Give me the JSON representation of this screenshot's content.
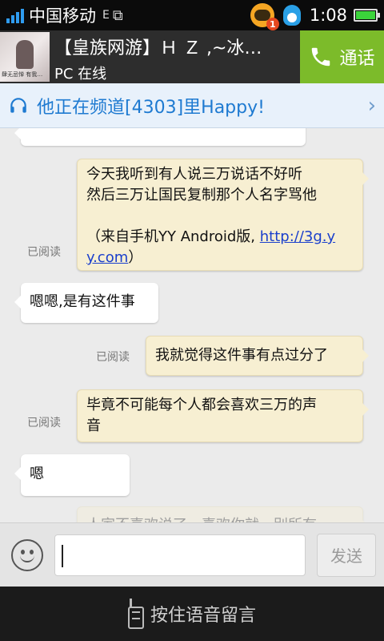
{
  "status_bar": {
    "carrier": "中国移动",
    "network_small": "E",
    "time": "1:08",
    "notification_badge": "1",
    "icons": [
      "signal-icon",
      "vibrate-icon",
      "yy-icon",
      "qq-icon",
      "battery-icon"
    ]
  },
  "header": {
    "title": "【皇族网游】Ｈ Ｚ ,~冰…",
    "status": "PC 在线",
    "avatar_caption": "肆无忌惮 有我…",
    "call_label": "通话",
    "colors": {
      "call_bg": "#7cbb2a",
      "header_bg": "#2d2d2d"
    }
  },
  "channel": {
    "text": "他正在频道[4303]里Happy!",
    "color": "#1e7ad1"
  },
  "messages": [
    {
      "side": "right",
      "read": "已阅读",
      "line1": "今天我听到有人说三万说话不好听",
      "line2": "然后三万让国民复制那个人名字骂他",
      "line3_prefix": "（来自手机YY Android版, ",
      "link_part1": "http://3g.y",
      "link_part2": "y.com",
      "line4_suffix": "）"
    },
    {
      "side": "left",
      "text": "嗯嗯,是有这件事"
    },
    {
      "side": "right",
      "read": "已阅读",
      "text": "我就觉得这件事有点过分了"
    },
    {
      "side": "right",
      "read": "已阅读",
      "line1": "毕竟不可能每个人都会喜欢三万的声",
      "line2": "音"
    },
    {
      "side": "left",
      "text": "嗯"
    },
    {
      "side": "right",
      "text": "人家不喜欢说了，喜欢你就…别所有"
    }
  ],
  "input": {
    "send_label": "发送",
    "voice_label": "按住语音留言"
  }
}
